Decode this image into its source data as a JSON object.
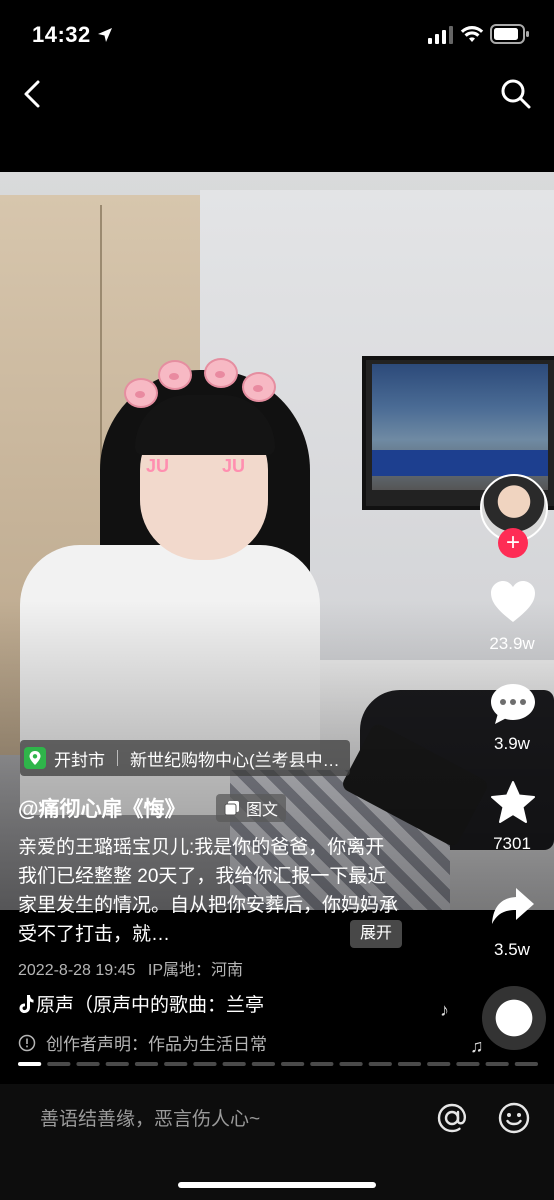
{
  "status_bar": {
    "time": "14:32"
  },
  "video": {
    "location": {
      "city": "开封市",
      "place": "新世纪购物中心(兰考县中…"
    },
    "author": "@痛彻心扉《悔》",
    "post_type_label": "图文",
    "caption": "亲爱的王璐瑶宝贝儿:我是你的爸爸，你离开我们已经整整 20天了，我给你汇报一下最近家里发生的情况。自从把你安葬后，你妈妈承受不了打击，就…",
    "expand_label": "展开",
    "date": "2022-8-28 19:45",
    "ip_location": "IP属地：河南",
    "music": "原声（原声中的歌曲：兰亭",
    "creator_statement": "创作者声明：作品为生活日常",
    "overlay_text": {
      "blush_left": "JU",
      "blush_right": "JU"
    }
  },
  "side_actions": {
    "likes": "23.9w",
    "comments": "3.9w",
    "favorites": "7301",
    "shares": "3.5w"
  },
  "comment_bar": {
    "placeholder": "善语结善缘，恶言伤人心~"
  },
  "colors": {
    "follow": "#fe2c55",
    "location_pin": "#2fb54a"
  },
  "progress": {
    "segments": 18,
    "active_segment": 1
  }
}
